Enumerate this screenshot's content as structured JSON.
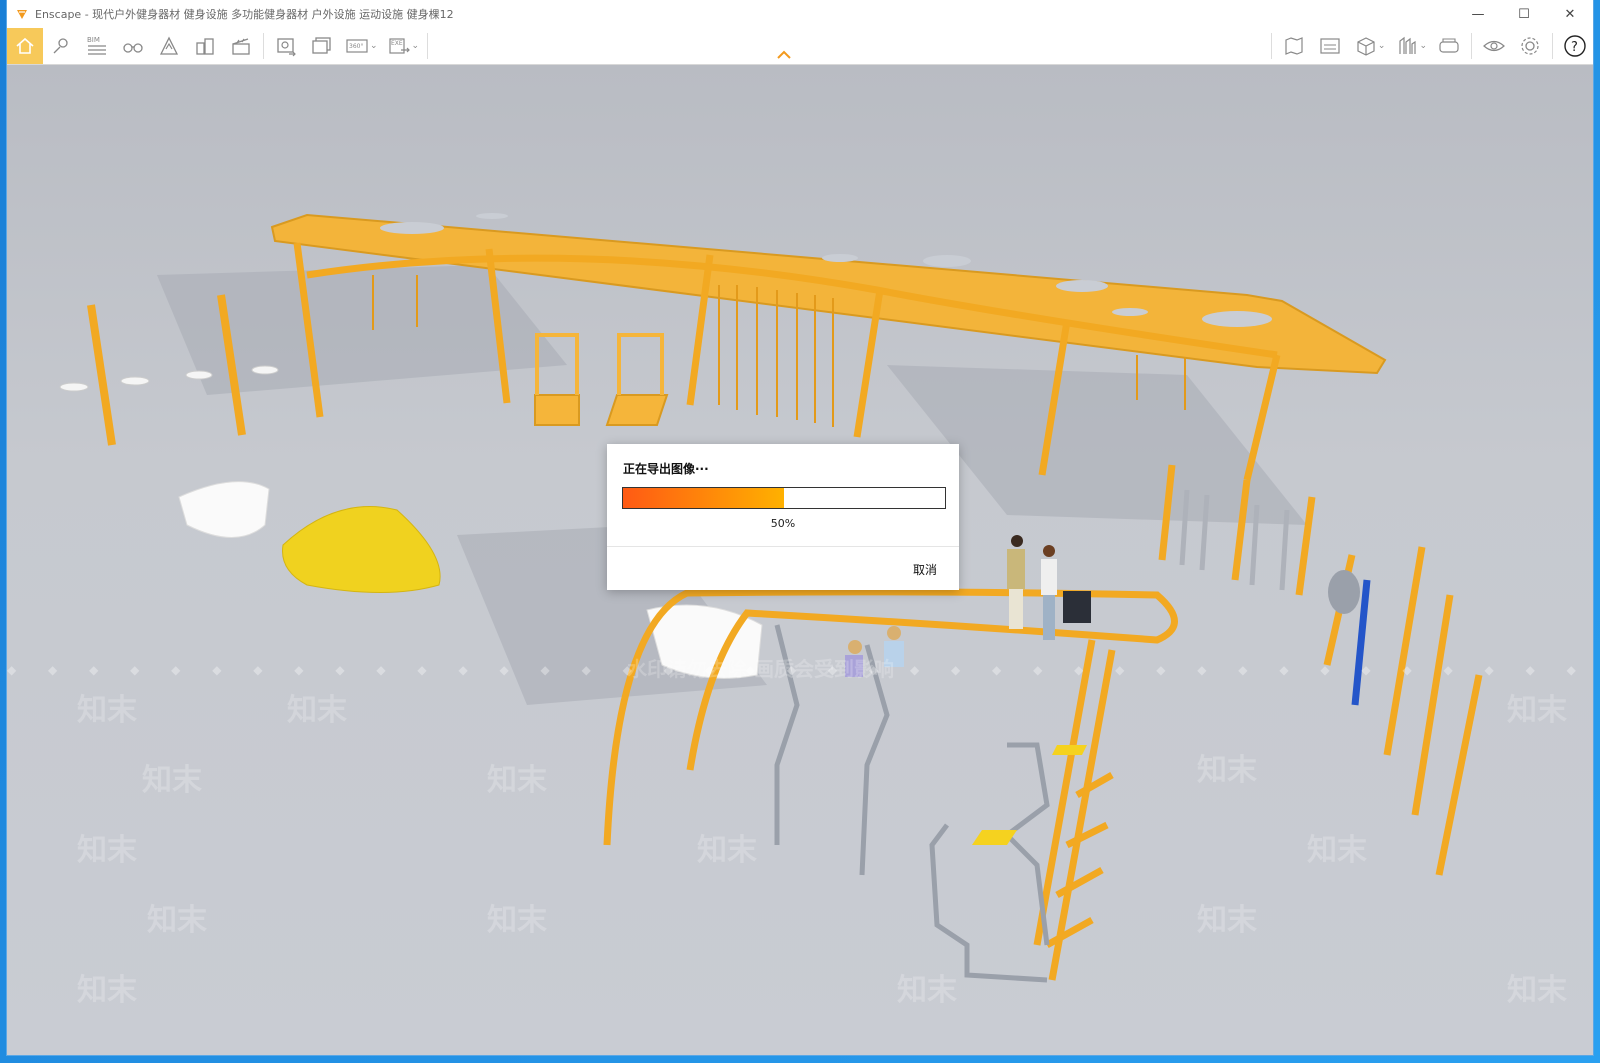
{
  "window": {
    "app_name": "Enscape",
    "title": "Enscape - 现代户外健身器材 健身设施 多功能健身器材 户外设施 运动设施 健身棵12",
    "controls": {
      "minimize": "—",
      "maximize": "☐",
      "close": "✕"
    }
  },
  "toolbar": {
    "left_icons": [
      "home-icon",
      "location-icon",
      "bim-icon",
      "binoculars-icon",
      "atmosphere-icon",
      "buildings-icon",
      "clapperboard-icon",
      "screenshot-icon",
      "batch-render-icon",
      "panorama-360-icon",
      "export-exe-icon"
    ],
    "bim_label": "BIM",
    "panorama_label": "360°",
    "exe_label": "EXE",
    "right_icons": [
      "map-icon",
      "image-view-icon",
      "cube-icon",
      "asset-library-icon",
      "vr-headset-icon",
      "eye-icon",
      "gear-icon",
      "help-icon"
    ],
    "help_label": "?",
    "active_color": "#f7c95a"
  },
  "watermark": {
    "text": "知末",
    "notice": "水印请勿去除 画质会受到影响"
  },
  "dialog": {
    "title": "正在导出图像···",
    "progress": 0.5,
    "progress_text": "50%",
    "cancel_label": "取消",
    "progress_colors": [
      "#ff5a14",
      "#ffb100"
    ]
  }
}
